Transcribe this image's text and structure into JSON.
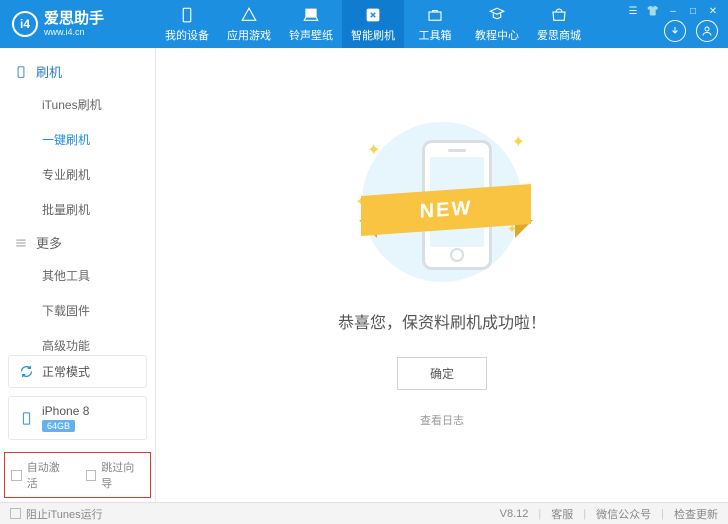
{
  "logo": {
    "letters": "i4",
    "title": "爱思助手",
    "url": "www.i4.cn"
  },
  "nav": [
    {
      "label": "我的设备"
    },
    {
      "label": "应用游戏"
    },
    {
      "label": "铃声壁纸"
    },
    {
      "label": "智能刷机"
    },
    {
      "label": "工具箱"
    },
    {
      "label": "教程中心"
    },
    {
      "label": "爱思商城"
    }
  ],
  "sidebar": {
    "flash_heading": "刷机",
    "flash_items": [
      "iTunes刷机",
      "一键刷机",
      "专业刷机",
      "批量刷机"
    ],
    "more_heading": "更多",
    "more_items": [
      "其他工具",
      "下载固件",
      "高级功能"
    ],
    "mode_label": "正常模式",
    "device_name": "iPhone 8",
    "device_storage": "64GB",
    "auto_activate": "自动激活",
    "skip_wizard": "跳过向导"
  },
  "main": {
    "ribbon_text": "NEW",
    "success_text": "恭喜您，保资料刷机成功啦！",
    "confirm": "确定",
    "view_log": "查看日志"
  },
  "footer": {
    "prevent_itunes": "阻止iTunes运行",
    "version": "V8.12",
    "support": "客服",
    "wechat": "微信公众号",
    "check_update": "检查更新"
  }
}
